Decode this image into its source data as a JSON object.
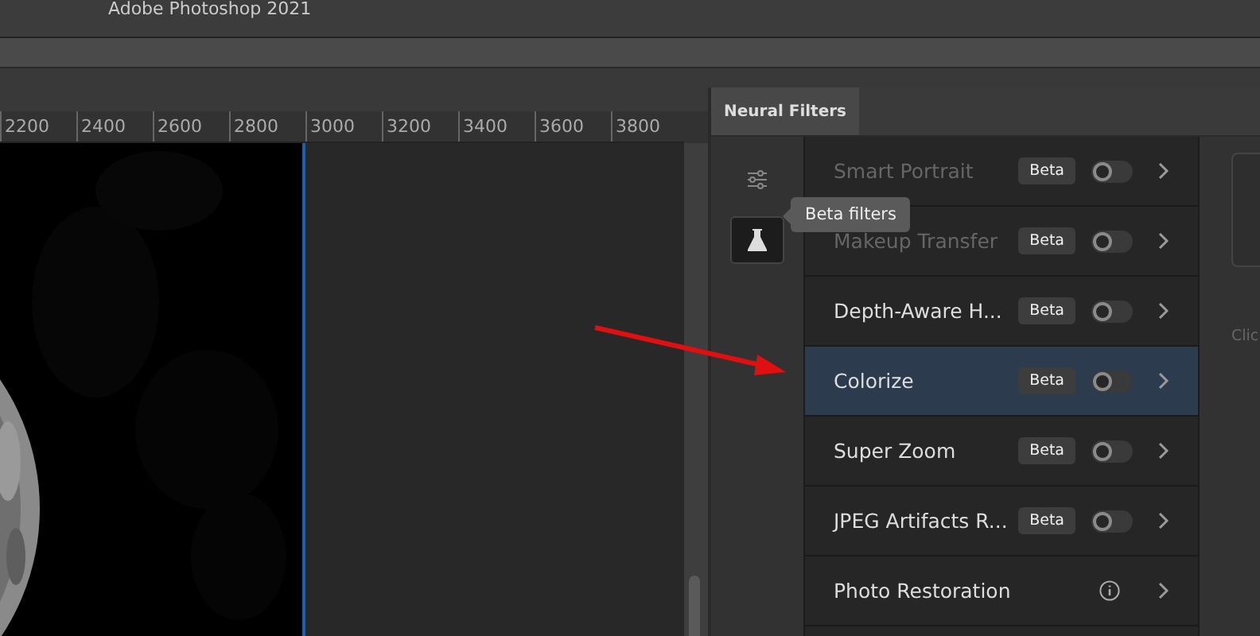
{
  "window": {
    "title": "Adobe Photoshop 2021"
  },
  "ruler": {
    "labels": [
      "2200",
      "2400",
      "2600",
      "2800",
      "3000",
      "3200",
      "3400",
      "3600",
      "3800"
    ]
  },
  "panel": {
    "tab": "Neural Filters",
    "side_buttons": [
      {
        "kind": "sliders",
        "selected": false
      },
      {
        "kind": "flask",
        "selected": true
      }
    ],
    "tooltip": "Beta filters",
    "filters": [
      {
        "name": "Smart Portrait",
        "kind": "toggle",
        "badge": "Beta",
        "on": false,
        "disabled": true,
        "selected": false
      },
      {
        "name": "Makeup Transfer",
        "kind": "toggle",
        "badge": "Beta",
        "on": false,
        "disabled": true,
        "selected": false
      },
      {
        "name": "Depth-Aware H...",
        "kind": "toggle",
        "badge": "Beta",
        "on": false,
        "disabled": false,
        "selected": false
      },
      {
        "name": "Colorize",
        "kind": "toggle",
        "badge": "Beta",
        "on": false,
        "disabled": false,
        "selected": true
      },
      {
        "name": "Super Zoom",
        "kind": "toggle",
        "badge": "Beta",
        "on": false,
        "disabled": false,
        "selected": false
      },
      {
        "name": "JPEG Artifacts R...",
        "kind": "toggle",
        "badge": "Beta",
        "on": false,
        "disabled": false,
        "selected": false
      },
      {
        "name": "Photo Restoration",
        "kind": "info",
        "disabled": false,
        "selected": false
      }
    ],
    "hint": "Clic"
  }
}
